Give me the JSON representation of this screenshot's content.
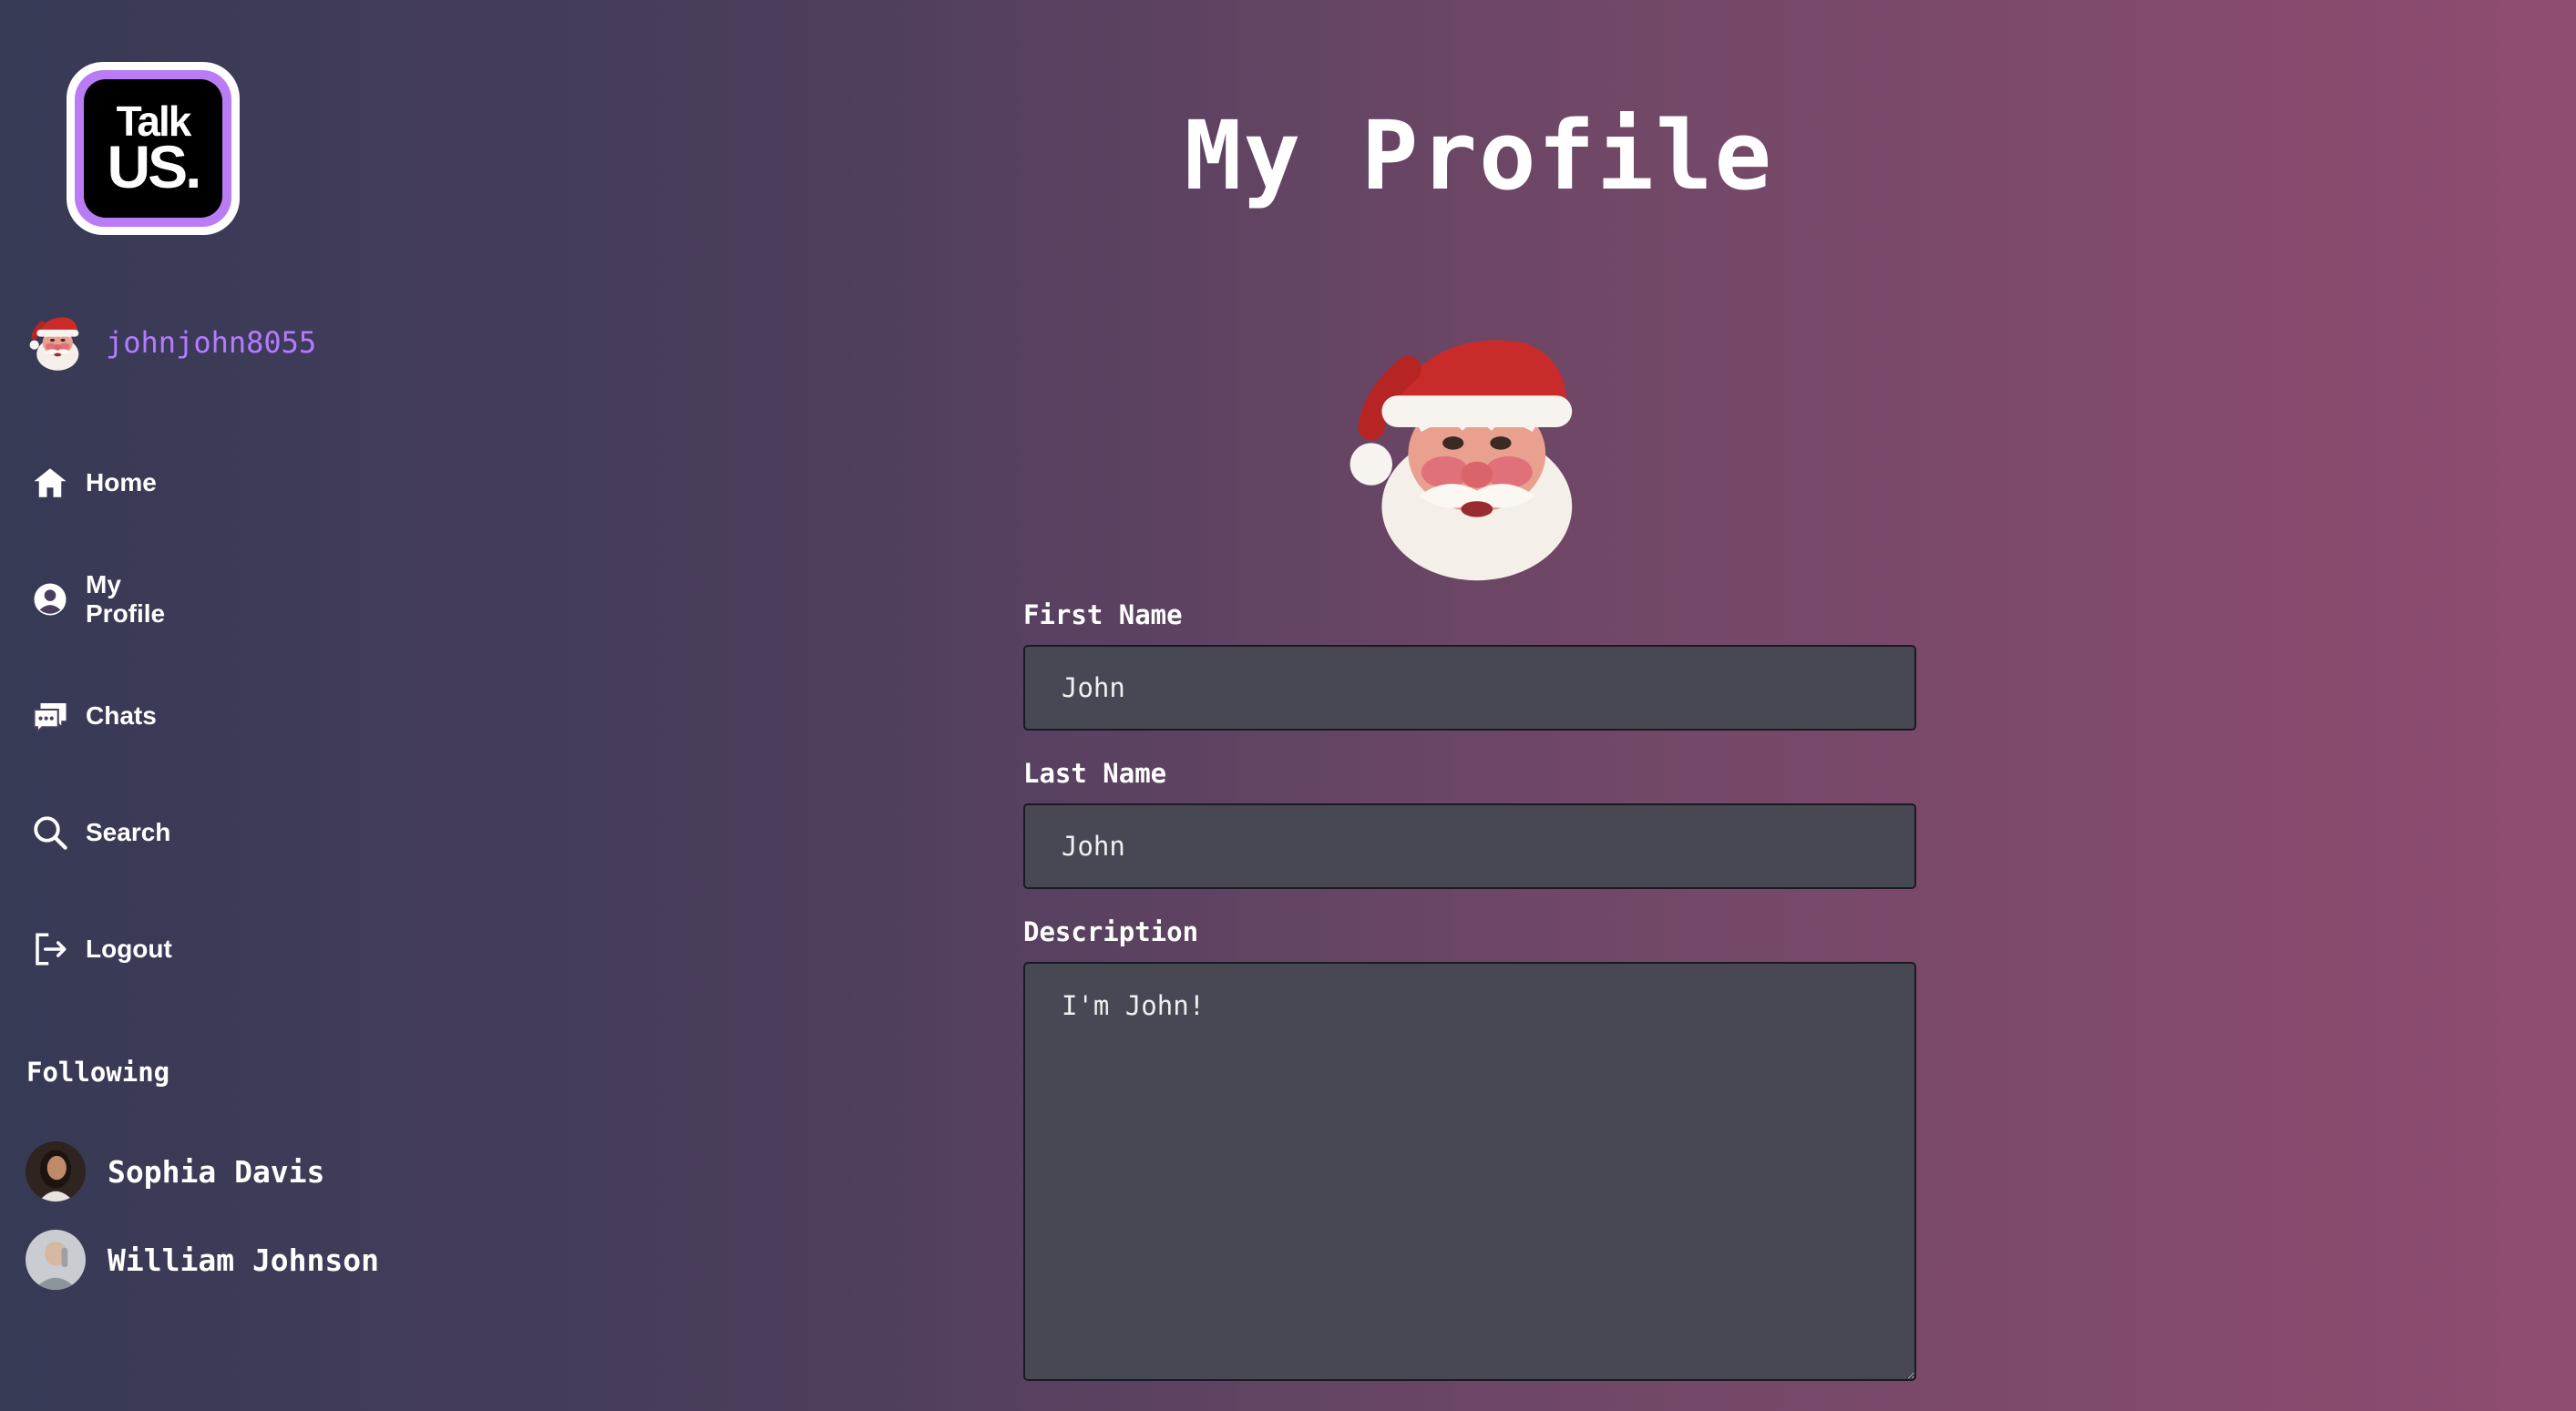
{
  "brand": {
    "logo_line1": "Talk",
    "logo_line2": "US."
  },
  "user": {
    "username": "johnjohn8055"
  },
  "nav": [
    {
      "label": "Home",
      "icon": "home-icon"
    },
    {
      "label": "My Profile",
      "icon": "user-circle-icon"
    },
    {
      "label": "Chats",
      "icon": "chat-icon"
    },
    {
      "label": "Search",
      "icon": "search-icon"
    },
    {
      "label": "Logout",
      "icon": "logout-icon"
    }
  ],
  "following": {
    "title": "Following",
    "users": [
      {
        "name": "Sophia Davis"
      },
      {
        "name": "William Johnson"
      }
    ]
  },
  "profile": {
    "title": "My Profile",
    "first_name_label": "First Name",
    "first_name_value": "John",
    "last_name_label": "Last Name",
    "last_name_value": "John",
    "description_label": "Description",
    "description_value": "I'm John!"
  },
  "colors": {
    "accent": "#b57bff",
    "field_bg": "#474853",
    "gradient_left": "#363a55",
    "gradient_right": "#8f4c71"
  }
}
